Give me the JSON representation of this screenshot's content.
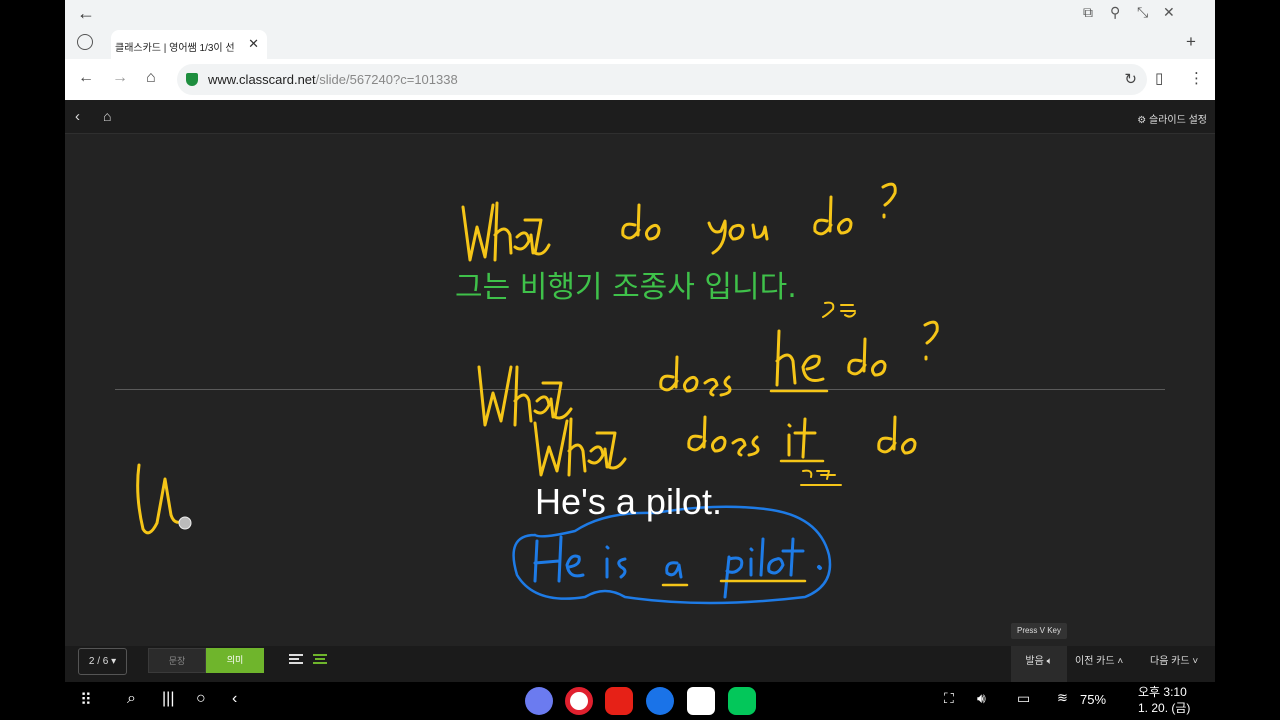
{
  "browser": {
    "tab_title": "클래스카드 | 영어쌤 1/3이 선",
    "url_host": "www.classcard.net",
    "url_path": "/slide/567240?c=101338"
  },
  "app_header": {
    "settings_label": "슬라이드 설정"
  },
  "slide": {
    "meaning_text": "그는 비행기 조종사 입니다.",
    "sentence_text": "He's a pilot.",
    "annotation_color": "#f5c518",
    "correction_color": "#1e7be6"
  },
  "toolbar": {
    "page_indicator": "2 / 6",
    "mode_sentence": "문장",
    "mode_meaning": "의미",
    "hint": "Press V Key",
    "pronounce": "발음",
    "prev_card": "이전 카드",
    "next_card": "다음 카드"
  },
  "system": {
    "battery": "75%",
    "time": "오후 3:10",
    "date": "1. 20. (금)"
  }
}
